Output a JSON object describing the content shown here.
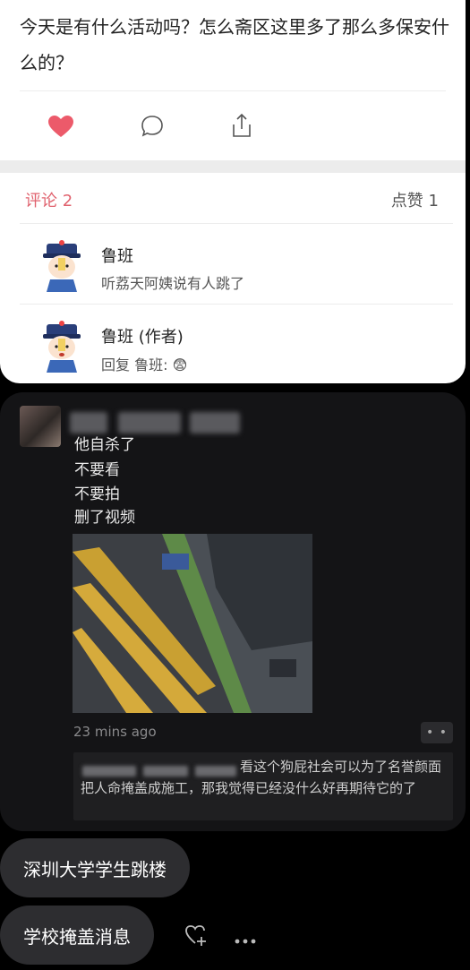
{
  "post": {
    "text": "今天是有什么活动吗？怎么斋区这里多了那么多保安什么的？"
  },
  "comments_header": {
    "count_label": "评论 2",
    "likes_label": "点赞 1"
  },
  "comments": [
    {
      "name": "鲁班",
      "text": "听荔天阿姨说有人跳了"
    },
    {
      "name": "鲁班 (作者)",
      "text": "回复 鲁班: 😨"
    }
  ],
  "message": {
    "lines": [
      "他自杀了",
      "不要看",
      "不要拍",
      "删了视频"
    ],
    "time": "23 mins ago",
    "more_label": "• •",
    "quote_text": "看这个狗屁社会可以为了名誉颜面把人命掩盖成施工，那我觉得已经没什么好再期待它的了"
  },
  "tags": [
    "深圳大学学生跳楼",
    "学校掩盖消息"
  ],
  "icons": [
    "heart-icon",
    "comment-icon",
    "share-icon",
    "heart-plus-icon",
    "more-icon"
  ],
  "colors": {
    "accent": "#e0626e",
    "heart": "#ec5a6a",
    "dark_bg": "#141416",
    "tag_bg": "#2d2d30"
  }
}
